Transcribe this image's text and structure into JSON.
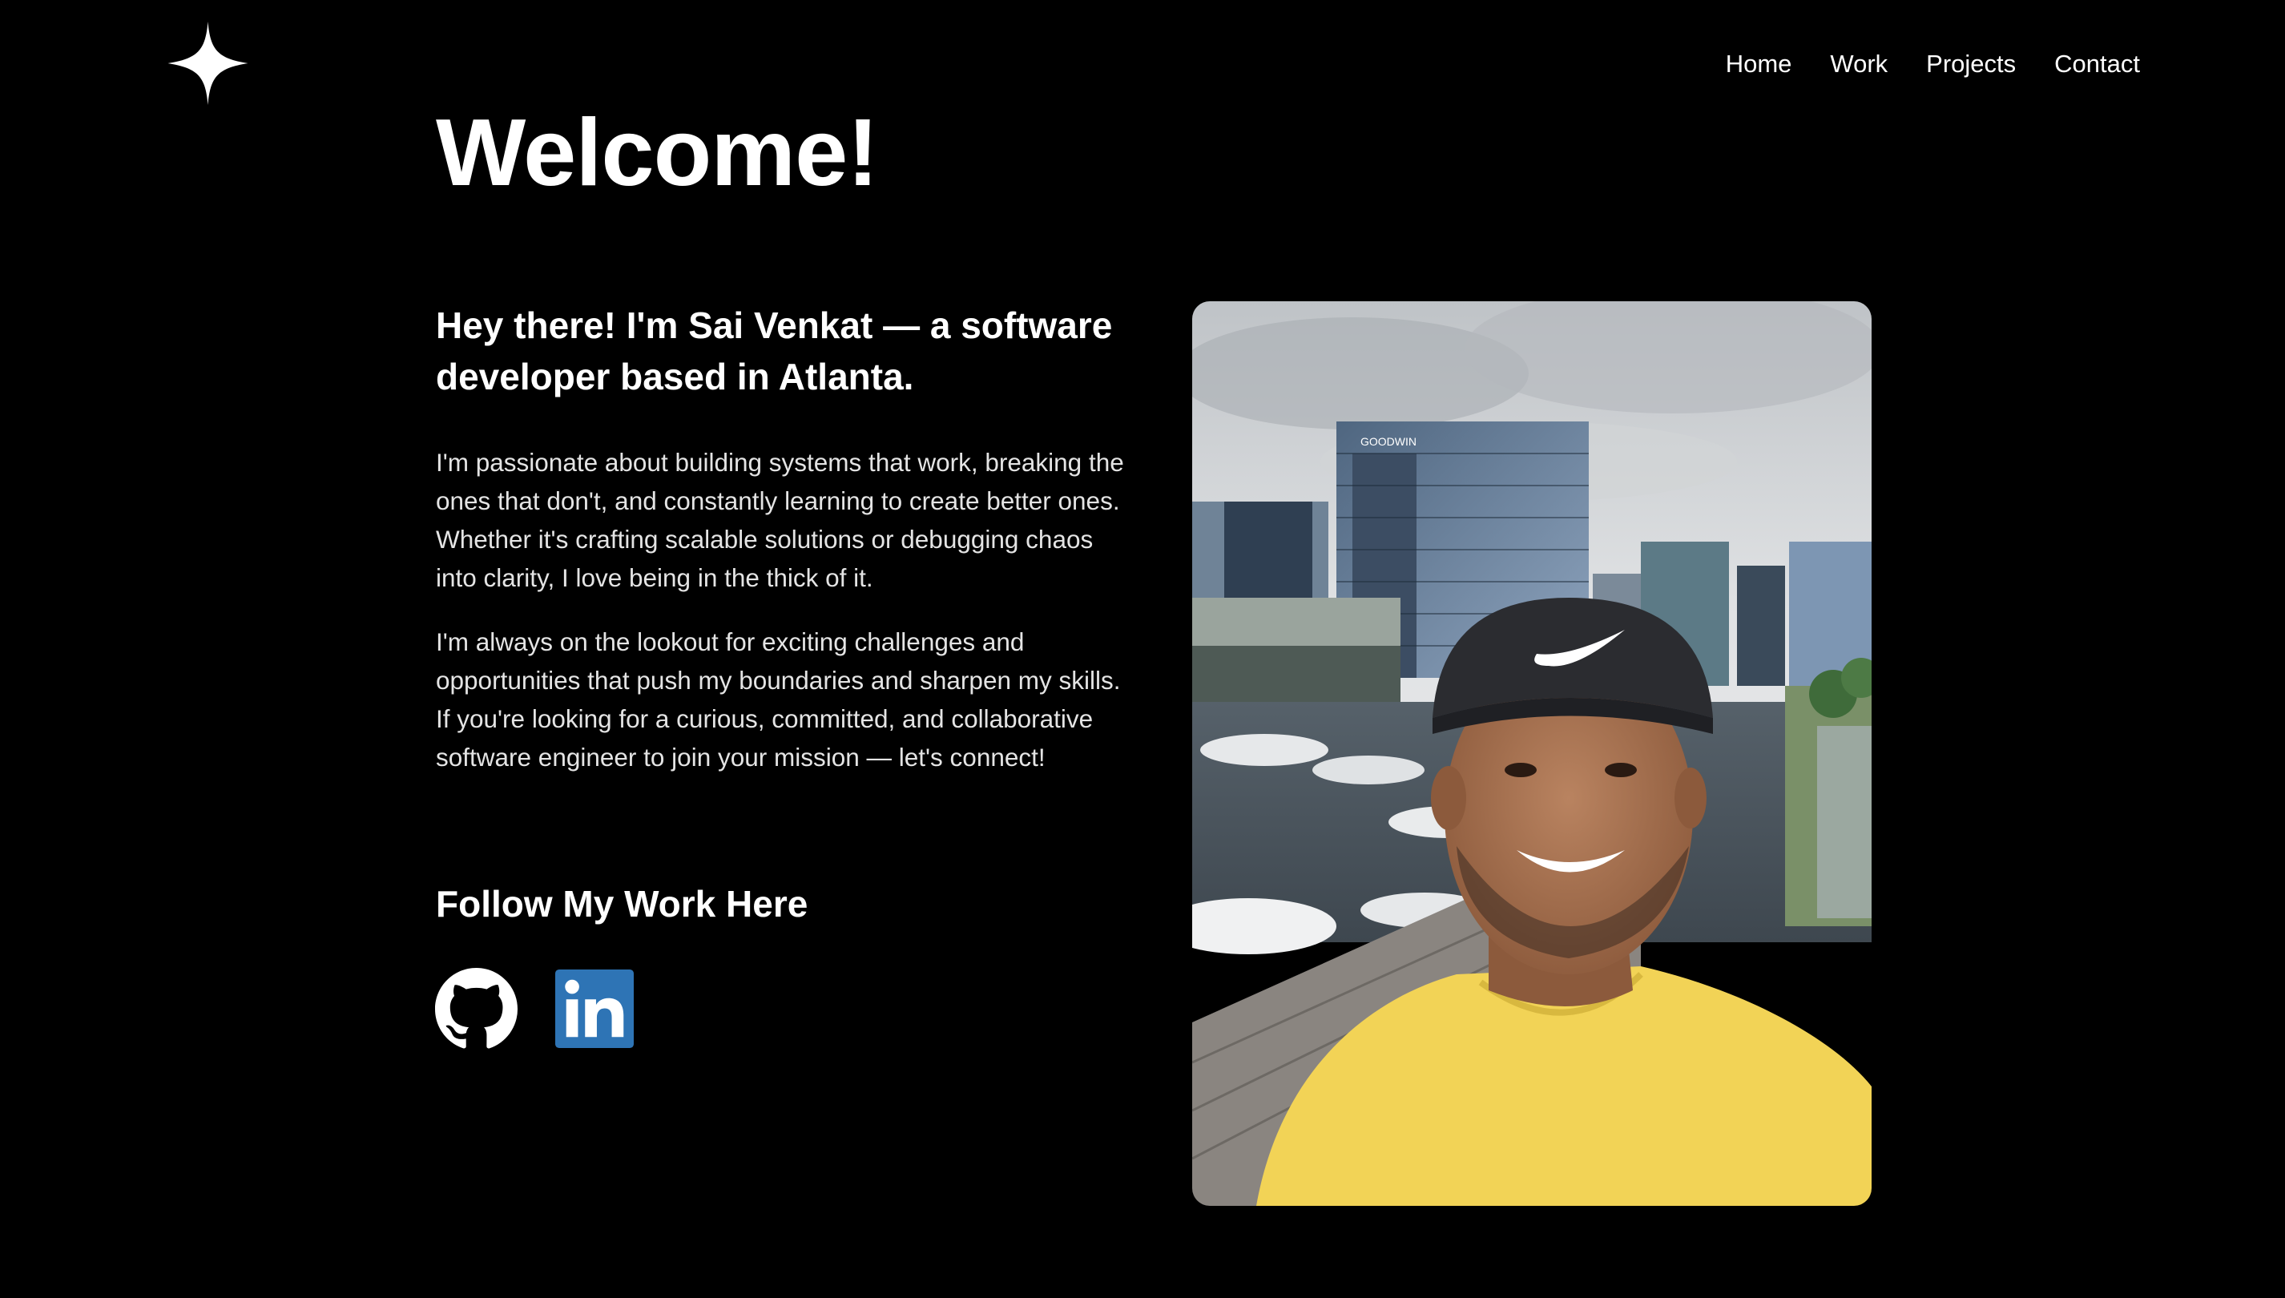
{
  "logo": {
    "icon": "sparkle-icon"
  },
  "nav": {
    "items": [
      {
        "label": "Home"
      },
      {
        "label": "Work"
      },
      {
        "label": "Projects"
      },
      {
        "label": "Contact"
      }
    ]
  },
  "main": {
    "title": "Welcome!",
    "intro": "Hey there! I'm Sai Venkat — a software developer based in Atlanta.",
    "paragraphs": [
      "I'm passionate about building systems that work, breaking the ones that don't, and constantly learning to create better ones. Whether it's crafting scalable solutions or debugging chaos into clarity, I love being in the thick of it.",
      "I'm always on the lookout for exciting challenges and opportunities that push my boundaries and sharpen my skills. If you're looking for a curious, committed, and collaborative software engineer to join your mission — let's connect!"
    ],
    "follow_heading": "Follow My Work Here",
    "social": [
      {
        "icon": "github-icon",
        "color": "#ffffff"
      },
      {
        "icon": "linkedin-icon",
        "color": "#2e74b5"
      }
    ]
  },
  "photo": {
    "icon": "profile-photo",
    "building_sign": "GOODWIN"
  },
  "colors": {
    "background": "#000000",
    "text": "#ffffff",
    "body_text": "#e4e4e4",
    "linkedin": "#2e74b5",
    "shirt": "#f2d356"
  }
}
